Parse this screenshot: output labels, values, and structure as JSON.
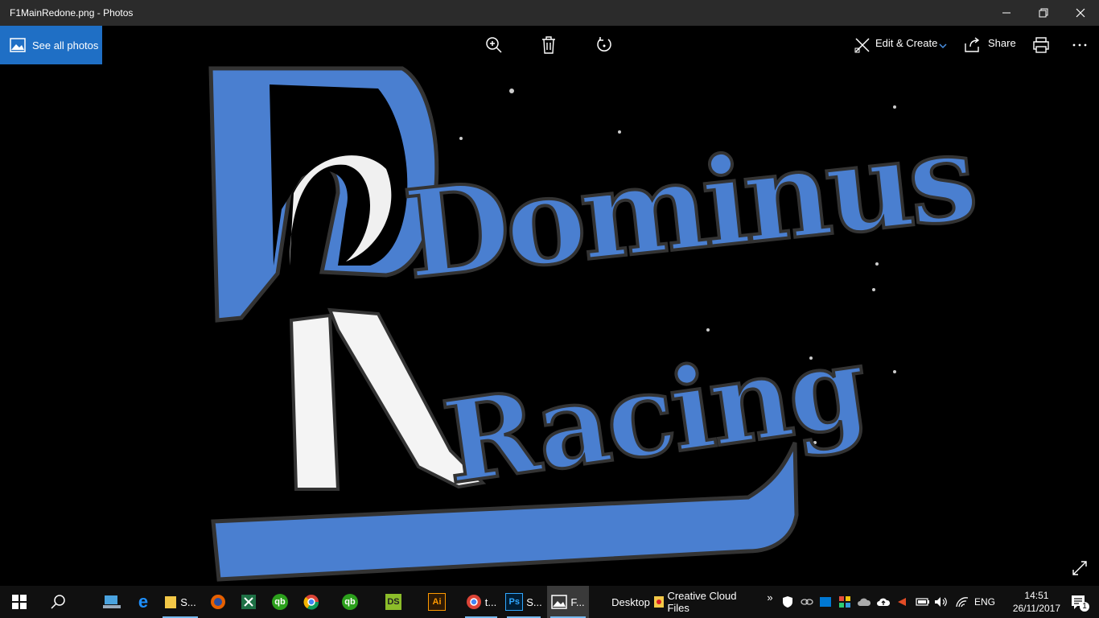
{
  "window": {
    "title": "F1MainRedone.png - Photos",
    "minimize_icon": "minimize-icon",
    "restore_icon": "restore-icon",
    "close_icon": "close-icon"
  },
  "toolbar": {
    "see_all_label": "See all photos",
    "edit_create_label": "Edit & Create",
    "share_label": "Share"
  },
  "photo": {
    "logo_text_1": "Dominus",
    "logo_text_2": "Racing",
    "logo_color": "#4a7fd0"
  },
  "taskbar": {
    "apps": [
      {
        "name": "file-explorer",
        "label": "S..."
      },
      {
        "name": "chrome-window",
        "label": "t..."
      },
      {
        "name": "photoshop-window",
        "label": "S..."
      },
      {
        "name": "photos-window",
        "label": "F..."
      }
    ],
    "desktop_label": "Desktop",
    "creative_cloud_label": "Creative Cloud Files",
    "language": "ENG",
    "time": "14:51",
    "date": "26/11/2017",
    "notification_count": "1"
  }
}
